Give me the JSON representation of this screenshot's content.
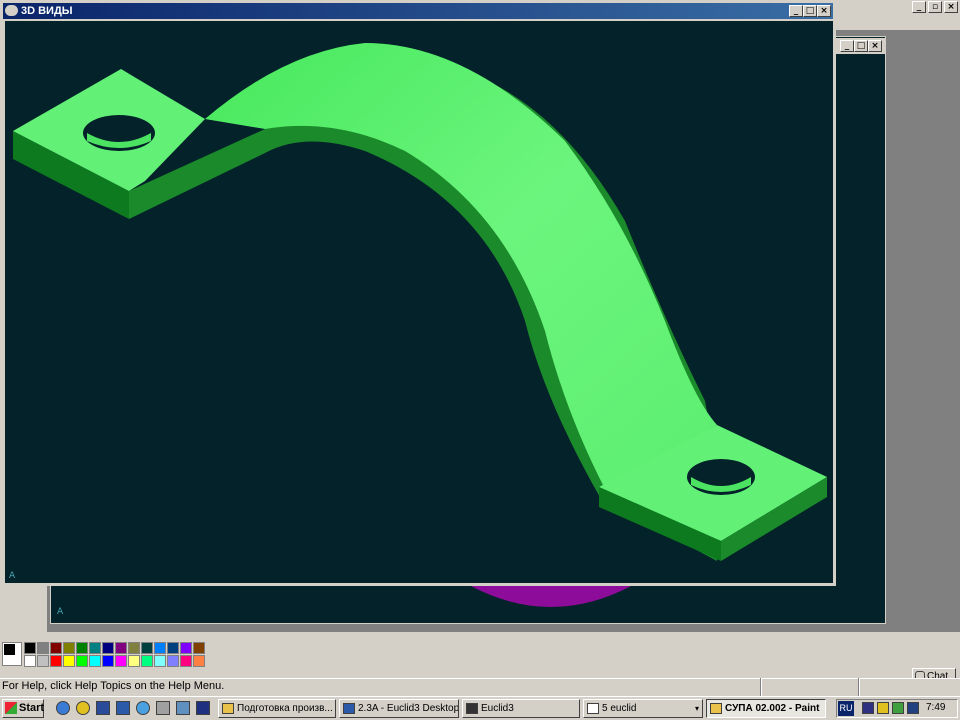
{
  "window_3d": {
    "title": "3D ВИДЫ",
    "axis_label": "A"
  },
  "window_2": {
    "axis_label": "A"
  },
  "status_bar": {
    "help_text": "For Help, click Help Topics on the Help Menu."
  },
  "taskbar": {
    "start_label": "Start",
    "buttons": [
      {
        "label": "Подготовка произв...",
        "icon_color": "#e8c24a"
      },
      {
        "label": "2.3A - Euclid3 Desktop",
        "icon_color": "#2a5aa8"
      },
      {
        "label": "Euclid3",
        "icon_color": "#333333"
      },
      {
        "label": "5 euclid",
        "icon_color": "#ffffff"
      },
      {
        "label": "СУПА 02.002 - Paint",
        "icon_color": "#e8c24a",
        "active": true
      }
    ],
    "language": "RU",
    "clock": "7:49"
  },
  "chat_button": {
    "label": "Chat"
  },
  "palette": {
    "row1": [
      "#000000",
      "#808080",
      "#800000",
      "#808000",
      "#008000",
      "#008080",
      "#000080",
      "#800080",
      "#808040",
      "#004040",
      "#0080ff",
      "#004080",
      "#8000ff",
      "#804000"
    ],
    "row2": [
      "#ffffff",
      "#c0c0c0",
      "#ff0000",
      "#ffff00",
      "#00ff00",
      "#00ffff",
      "#0000ff",
      "#ff00ff",
      "#ffff80",
      "#00ff80",
      "#80ffff",
      "#8080ff",
      "#ff0080",
      "#ff8040"
    ]
  },
  "colors": {
    "model_green": "#4ef06a",
    "viewport_bg": "#032229",
    "title_bar": "#0a246a"
  }
}
